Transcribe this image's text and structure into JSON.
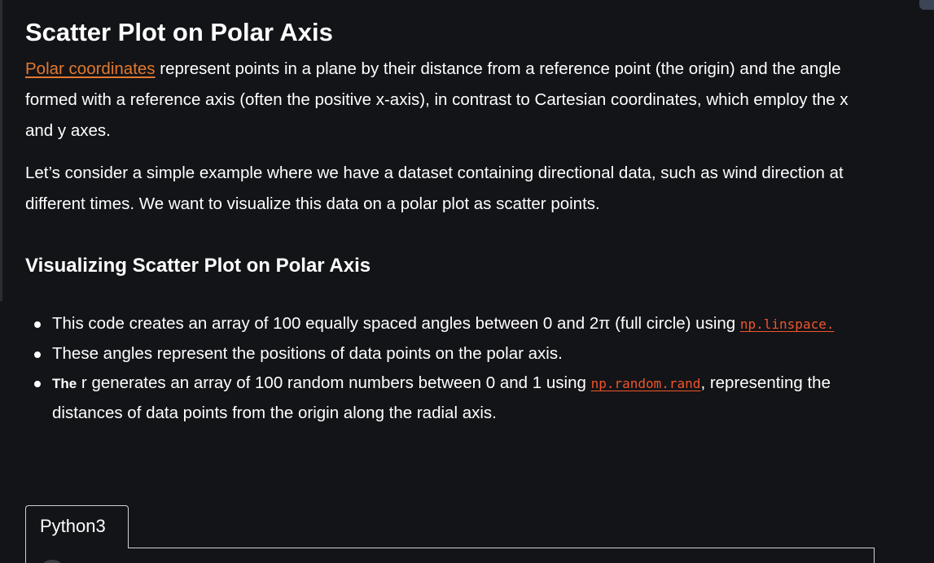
{
  "article": {
    "title": "Scatter Plot on Polar Axis",
    "para1": {
      "link_text": "Polar coordinates",
      "text": " represent points in a plane by their distance from a reference point (the origin) and the angle formed with a reference axis (often the positive x-axis), in contrast to Cartesian coordinates, which employ the x and y axes."
    },
    "para2": "Let’s consider a simple example where we have a dataset containing directional data, such as wind direction at different times. We want to visualize this data on a polar plot as scatter points.",
    "subtitle": "Visualizing Scatter Plot on Polar Axis",
    "bullets": {
      "b1_text": "This code creates an array of 100 equally spaced angles between 0 and 2π (full circle) using ",
      "b1_code": "np.linspace.",
      "b2_text": "These angles represent the positions of data points on the polar axis.",
      "b3_strong": "The",
      "b3_text": " r generates an array of 100 random numbers between 0 and 1 using ",
      "b3_code": "np.random.rand",
      "b3_after": ", representing the distances of data points from the origin along the radial axis."
    }
  },
  "code_block": {
    "tab_label": "Python3"
  },
  "colors": {
    "background": "#131417",
    "link": "#e2792f",
    "inline_code": "#f0542b",
    "text": "#ffffff"
  }
}
